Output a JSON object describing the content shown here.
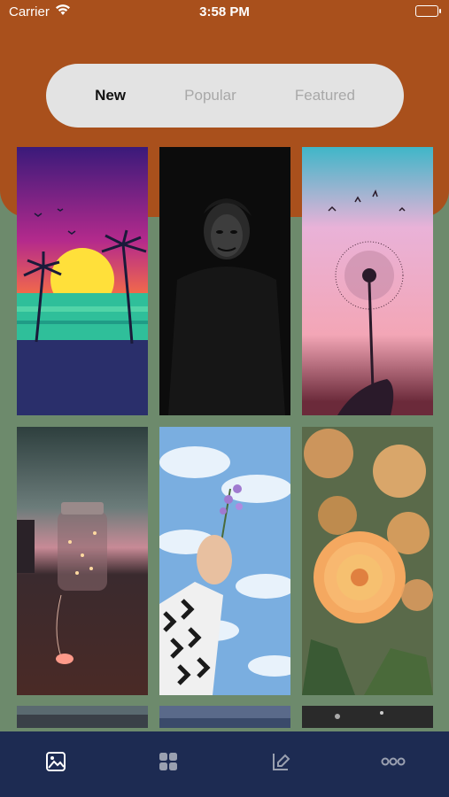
{
  "status_bar": {
    "carrier": "Carrier",
    "time": "3:58 PM",
    "wifi_icon": "wifi-icon",
    "battery_icon": "battery-icon"
  },
  "segments": {
    "items": [
      {
        "label": "New",
        "active": true
      },
      {
        "label": "Popular",
        "active": false
      },
      {
        "label": "Featured",
        "active": false
      }
    ]
  },
  "wallpapers": [
    {
      "subject": "sunset-palm-beach"
    },
    {
      "subject": "dark-joker-portrait"
    },
    {
      "subject": "dandelion-sunset"
    },
    {
      "subject": "glowing-jar-lights"
    },
    {
      "subject": "hand-flower-sky"
    },
    {
      "subject": "orange-dahlia-flowers"
    },
    {
      "subject": "partial-wallpaper-1"
    },
    {
      "subject": "partial-wallpaper-2"
    },
    {
      "subject": "partial-wallpaper-3"
    }
  ],
  "tabbar": {
    "items": [
      {
        "icon": "image-icon",
        "active": true
      },
      {
        "icon": "grid-icon",
        "active": false
      },
      {
        "icon": "brush-icon",
        "active": false
      },
      {
        "icon": "more-icon",
        "active": false
      }
    ]
  },
  "colors": {
    "header": "#a9501c",
    "background": "#6d8a6c",
    "tabbar": "#1d2b52",
    "segment_bg": "#e3e3e3"
  }
}
